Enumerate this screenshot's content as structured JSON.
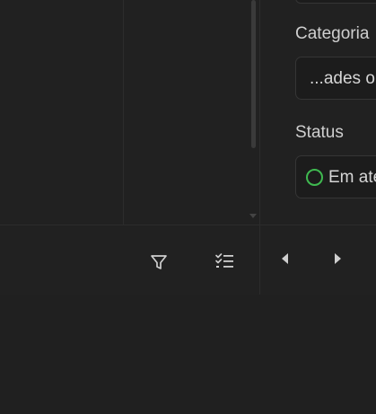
{
  "details": {
    "category": {
      "label": "Categoria",
      "value": "...ades o"
    },
    "status": {
      "label": "Status",
      "value": "Em ate",
      "color": "#3fb950"
    }
  },
  "toolbar": {
    "icons": [
      "filter-icon",
      "checklist-icon",
      "chevron-left-icon",
      "chevron-right-icon"
    ]
  }
}
